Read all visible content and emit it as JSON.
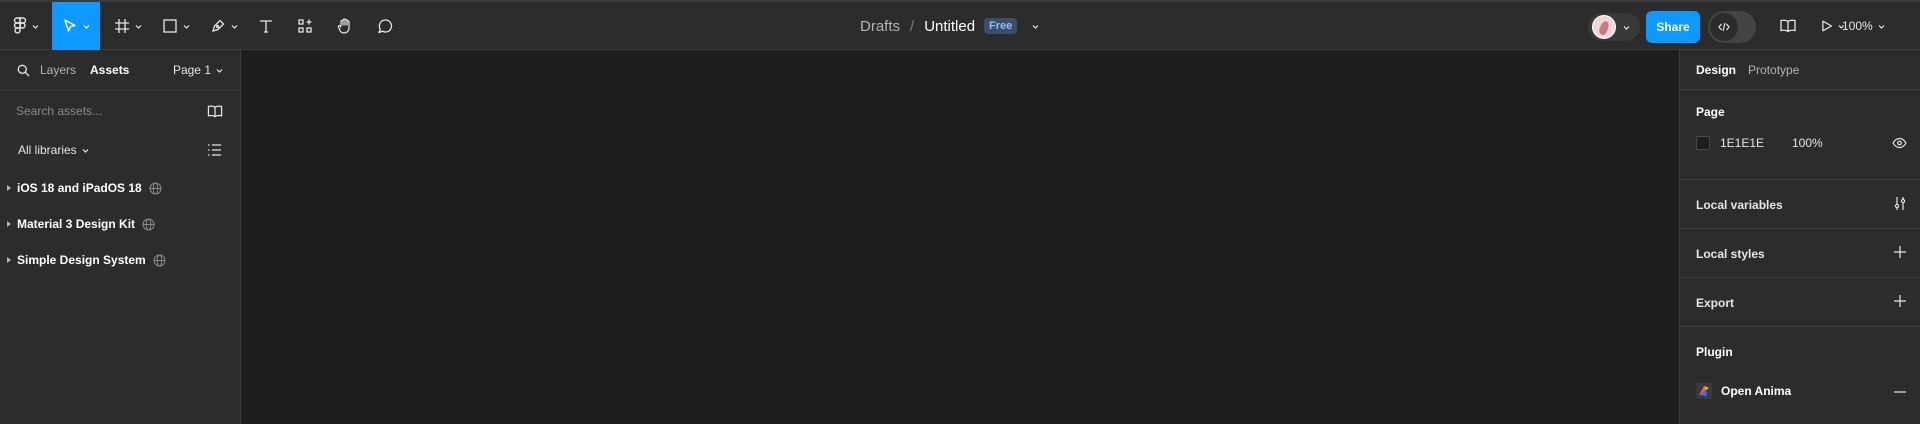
{
  "toolbar": {
    "breadcrumb": "Drafts",
    "separator": "/",
    "file_name": "Untitled",
    "plan_badge": "Free",
    "share_label": "Share",
    "zoom_label": "100%",
    "accent_color": "#0d99ff"
  },
  "left_panel": {
    "tabs": [
      {
        "label": "Layers",
        "active": false
      },
      {
        "label": "Assets",
        "active": true
      }
    ],
    "page_selector": "Page 1",
    "search_placeholder": "Search assets...",
    "library_filter": "All libraries",
    "libraries": [
      {
        "name": "iOS 18 and iPadOS 18",
        "icon": "globe-icon"
      },
      {
        "name": "Material 3 Design Kit",
        "icon": "globe-icon"
      },
      {
        "name": "Simple Design System",
        "icon": "globe-icon"
      }
    ]
  },
  "right_panel": {
    "tabs": [
      {
        "label": "Design",
        "active": true
      },
      {
        "label": "Prototype",
        "active": false
      }
    ],
    "page_section": {
      "title": "Page",
      "color_hex": "1E1E1E",
      "opacity": "100%",
      "swatch_color": "#1e1e1e"
    },
    "local_variables": "Local variables",
    "local_styles": "Local styles",
    "export": "Export",
    "plugin_section": {
      "title": "Plugin",
      "plugin_name": "Open Anima"
    }
  }
}
